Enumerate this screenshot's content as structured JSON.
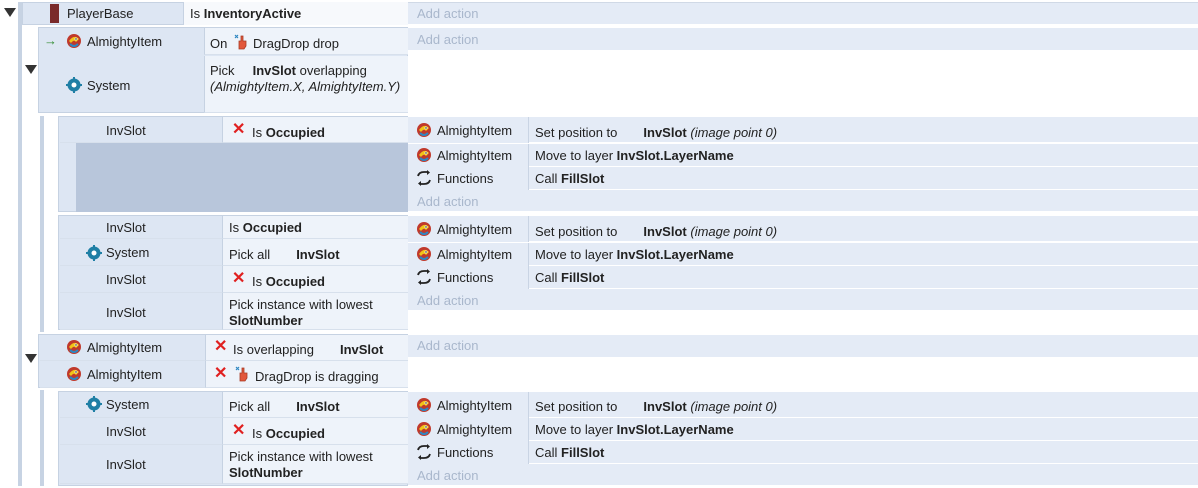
{
  "event1": {
    "object": "PlayerBase",
    "condition_pre": "Is",
    "condition_bold": "InventoryActive",
    "add_action": "Add action"
  },
  "sub1": {
    "trigger_object": "AlmightyItem",
    "trigger_on": "On",
    "trigger_text": "DragDrop drop",
    "add_action": "Add action",
    "system_label": "System",
    "pick_pre": "Pick",
    "pick_bold": "InvSlot",
    "pick_post": "overlapping",
    "pick_params": "(AlmightyItem.X, AlmightyItem.Y)"
  },
  "sub1a": {
    "cond_object": "InvSlot",
    "cond_pre": "Is",
    "cond_bold": "Occupied",
    "actions": [
      {
        "object": "AlmightyItem",
        "pre": "Set position to",
        "bold": "InvSlot",
        "post": "(image point 0)"
      },
      {
        "object": "AlmightyItem",
        "pre": "Move to layer",
        "bold": "InvSlot.LayerName",
        "post": ""
      },
      {
        "object": "Functions",
        "pre": "Call",
        "bold": "FillSlot",
        "post": ""
      }
    ],
    "add_action": "Add action"
  },
  "sub1b": {
    "conditions": [
      {
        "object": "InvSlot",
        "pre": "Is",
        "bold": "Occupied"
      },
      {
        "object": "System",
        "pre": "Pick all",
        "bold": "InvSlot"
      },
      {
        "object": "InvSlot",
        "pre": "Is",
        "bold": "Occupied"
      },
      {
        "object": "InvSlot",
        "pre": "Pick instance with lowest",
        "bold": "SlotNumber"
      }
    ],
    "actions": [
      {
        "object": "AlmightyItem",
        "pre": "Set position to",
        "bold": "InvSlot",
        "post": "(image point 0)"
      },
      {
        "object": "AlmightyItem",
        "pre": "Move to layer",
        "bold": "InvSlot.LayerName",
        "post": ""
      },
      {
        "object": "Functions",
        "pre": "Call",
        "bold": "FillSlot",
        "post": ""
      }
    ],
    "add_action": "Add action"
  },
  "sub2": {
    "conditions": [
      {
        "object": "AlmightyItem",
        "pre": "Is overlapping",
        "bold": "InvSlot"
      },
      {
        "object": "AlmightyItem",
        "pre": "DragDrop is dragging",
        "bold": ""
      }
    ],
    "add_action": "Add action"
  },
  "sub2a": {
    "conditions": [
      {
        "object": "System",
        "pre": "Pick all",
        "bold": "InvSlot"
      },
      {
        "object": "InvSlot",
        "pre": "Is",
        "bold": "Occupied"
      },
      {
        "object": "InvSlot",
        "pre": "Pick instance with lowest",
        "bold": "SlotNumber"
      }
    ],
    "actions": [
      {
        "object": "AlmightyItem",
        "pre": "Set position to",
        "bold": "InvSlot",
        "post": "(image point 0)"
      },
      {
        "object": "AlmightyItem",
        "pre": "Move to layer",
        "bold": "InvSlot.LayerName",
        "post": ""
      },
      {
        "object": "Functions",
        "pre": "Call",
        "bold": "FillSlot",
        "post": ""
      }
    ],
    "add_action": "Add action"
  },
  "colors": {
    "block": "#dde6f3",
    "condition": "#eef3fa",
    "action": "#e4ebf6",
    "add_action": "#a9b7cc",
    "invert_x": "#e02020",
    "group_bar": "#7a2a2a"
  }
}
